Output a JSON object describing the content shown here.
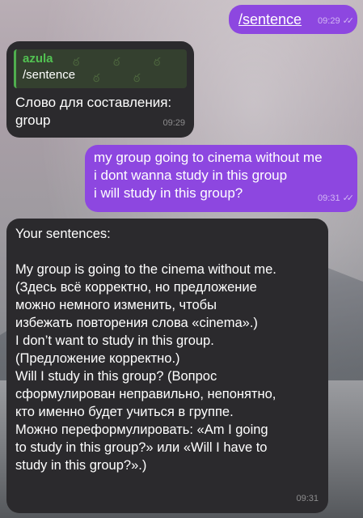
{
  "messages": {
    "m1": {
      "text": "/sentence",
      "time": "09:29"
    },
    "m2": {
      "reply_name": "azula",
      "reply_text": "/sentence",
      "lines": [
        "Слово для составления:",
        "group"
      ],
      "time": "09:29"
    },
    "m3": {
      "lines": [
        "my group going to cinema without me",
        "i dont wanna study in this group",
        "i will study in this group?"
      ],
      "time": "09:31"
    },
    "m4": {
      "lines": [
        "Your sentences:",
        "",
        "My group is going to the cinema without me.",
        "(Здесь всё корректно, но предложение",
        "можно немного изменить, чтобы",
        "избежать повторения слова «cinema».)",
        "I don’t want to study in this group.",
        "(Предложение корректно.)",
        "Will I study in this group? (Вопрос",
        "сформулирован неправильно, непонятно,",
        "кто именно будет учиться в группе.",
        "Можно переформулировать: «Am I going",
        "to study in this group?» или «Will I have to",
        "study in this group?».)"
      ],
      "time": "09:31"
    }
  },
  "colors": {
    "outgoing": "#8d47e0",
    "incoming": "#2b2a2d",
    "reply_accent": "#52c252"
  }
}
